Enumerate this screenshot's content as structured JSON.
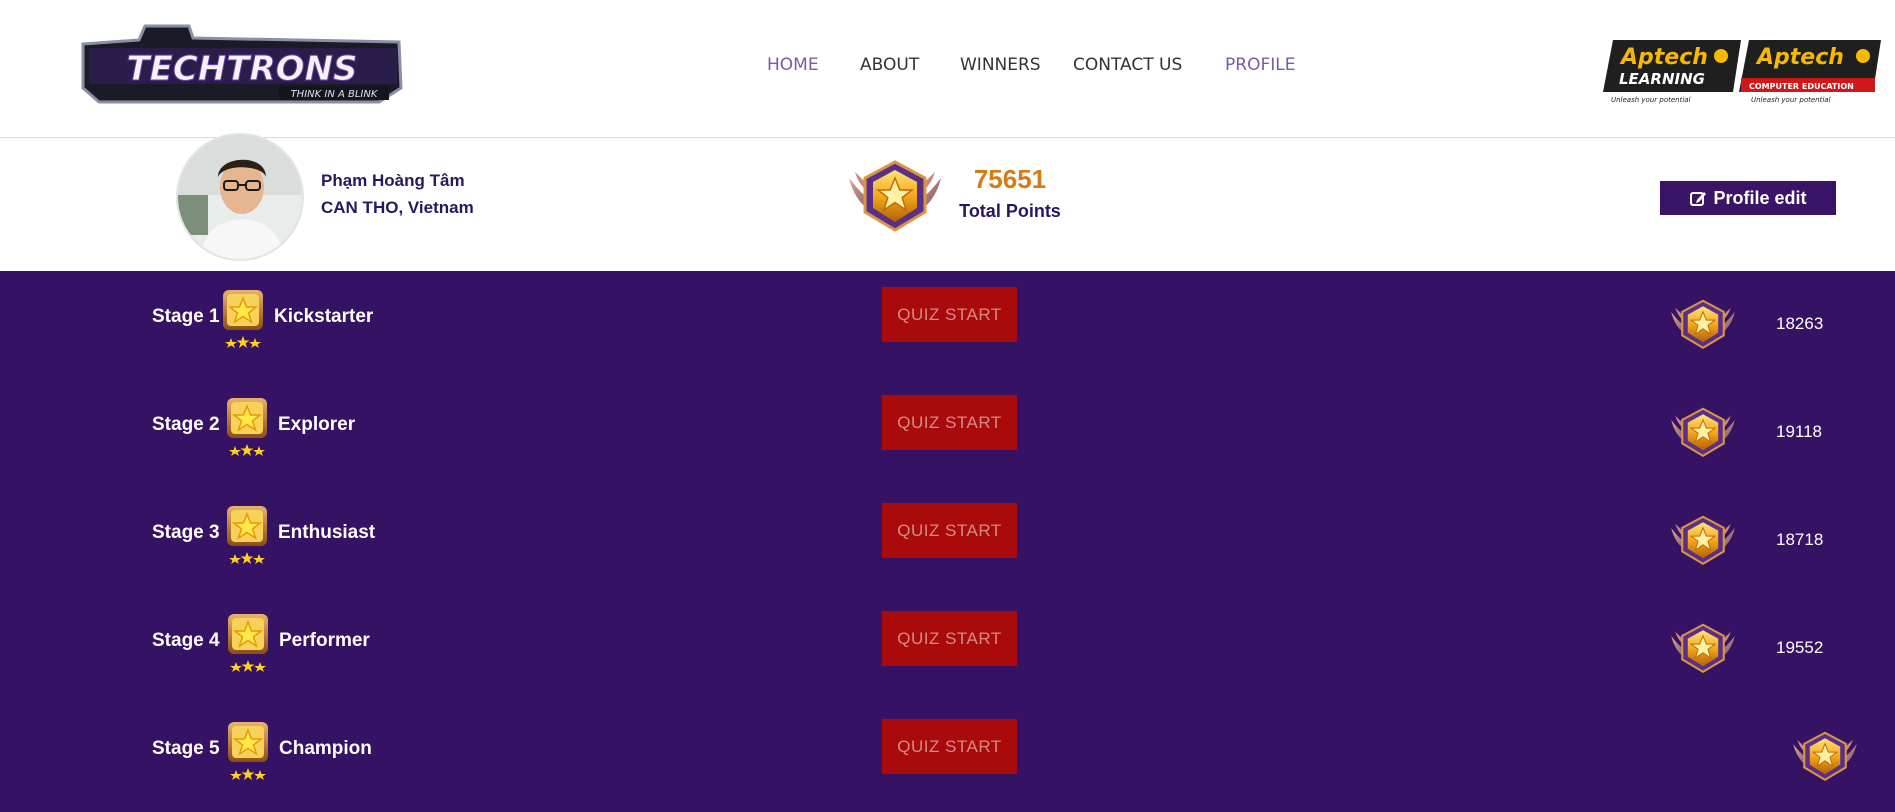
{
  "brand": {
    "logo_text": "TECHTRONS",
    "logo_tagline": "THINK IN A BLINK",
    "partner_1_name": "Aptech",
    "partner_1_sub": "LEARNING",
    "partner_1_tag": "Unleash your potential",
    "partner_2_name": "Aptech",
    "partner_2_sub": "COMPUTER EDUCATION",
    "partner_2_tag": "Unleash your potential"
  },
  "nav": {
    "items": [
      {
        "label": "HOME",
        "active": true
      },
      {
        "label": "ABOUT",
        "active": false
      },
      {
        "label": "WINNERS",
        "active": false
      },
      {
        "label": "CONTACT US",
        "active": false
      },
      {
        "label": "PROFILE",
        "active": true
      }
    ]
  },
  "profile": {
    "name": "Phạm Hoàng Tâm",
    "location": "CAN THO,  Vietnam",
    "total_points": "75651",
    "total_points_label": "Total Points",
    "edit_label": "Profile edit"
  },
  "stages": [
    {
      "label": "Stage 1",
      "name": "Kickstarter",
      "button": "QUIZ START",
      "score": "18263"
    },
    {
      "label": "Stage 2",
      "name": "Explorer",
      "button": "QUIZ START",
      "score": "19118"
    },
    {
      "label": "Stage 3",
      "name": "Enthusiast",
      "button": "QUIZ START",
      "score": "18718"
    },
    {
      "label": "Stage 4",
      "name": "Performer",
      "button": "QUIZ START",
      "score": "19552"
    },
    {
      "label": "Stage 5",
      "name": "Champion",
      "button": "QUIZ START",
      "score": ""
    }
  ],
  "colors": {
    "stage_bg": "#351264",
    "quiz_button": "#a90b0b",
    "points_orange": "#d77a18",
    "nav_active": "#7a5aa0",
    "edit_button": "#3a1467"
  },
  "icons": {
    "medal": "star-medal-icon",
    "rank_badge": "winged-star-badge-icon",
    "edit": "edit-icon"
  }
}
